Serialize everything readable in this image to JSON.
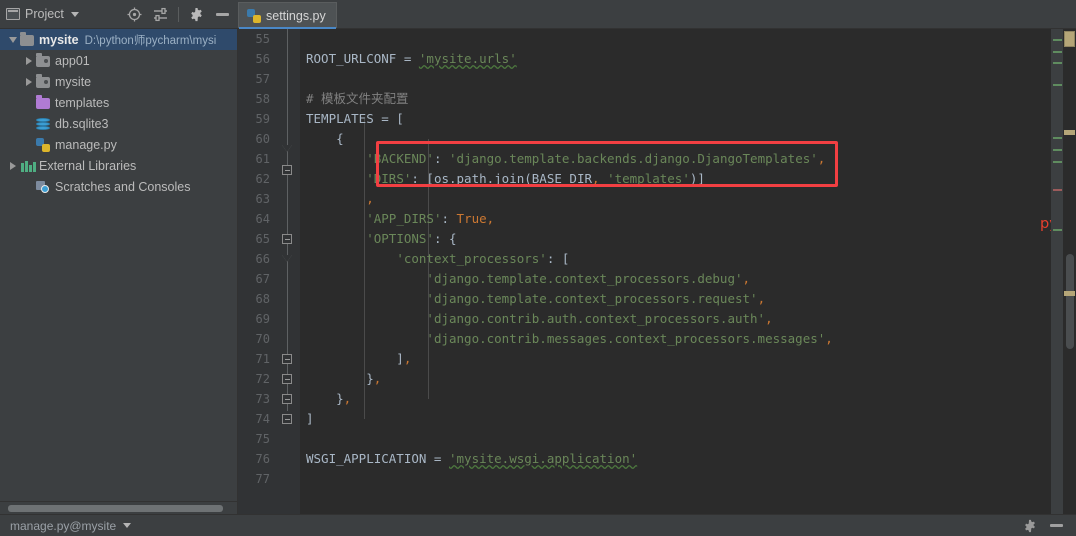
{
  "window": {
    "app": "PyCharm"
  },
  "project_toolbar": {
    "title": "Project",
    "icons": [
      {
        "name": "select-opened-file-icon",
        "glyph": "target"
      },
      {
        "name": "collapse-all-icon",
        "glyph": "sliders"
      },
      {
        "name": "settings-gear-icon",
        "glyph": "gear"
      },
      {
        "name": "hide-panel-icon",
        "glyph": "minus"
      }
    ]
  },
  "tabs": [
    {
      "label": "settings.py",
      "icon": "python-file-icon",
      "active": true
    }
  ],
  "project_tree": [
    {
      "label": "mysite",
      "path": "D:\\python师pycharm\\mysi",
      "icon": "folder-root-icon",
      "indent": 0,
      "arrow": "open",
      "selected": true,
      "bold": true
    },
    {
      "label": "app01",
      "path": "",
      "icon": "folder-module-icon",
      "indent": 1,
      "arrow": "closed",
      "selected": false,
      "bold": false
    },
    {
      "label": "mysite",
      "path": "",
      "icon": "folder-module-icon",
      "indent": 1,
      "arrow": "closed",
      "selected": false,
      "bold": false
    },
    {
      "label": "templates",
      "path": "",
      "icon": "folder-template-icon",
      "indent": 1,
      "arrow": "none",
      "selected": false,
      "bold": false
    },
    {
      "label": "db.sqlite3",
      "path": "",
      "icon": "database-file-icon",
      "indent": 1,
      "arrow": "none",
      "selected": false,
      "bold": false
    },
    {
      "label": "manage.py",
      "path": "",
      "icon": "python-file-icon",
      "indent": 1,
      "arrow": "none",
      "selected": false,
      "bold": false
    },
    {
      "label": "External Libraries",
      "path": "",
      "icon": "library-icon",
      "indent": 0,
      "arrow": "closed",
      "selected": false,
      "bold": false
    },
    {
      "label": "Scratches and Consoles",
      "path": "",
      "icon": "scratches-icon",
      "indent": 0,
      "arrow": "none",
      "selected": false,
      "bold": false
    }
  ],
  "editor": {
    "first_line": 55,
    "last_line": 77,
    "line_height": 20,
    "lines": [
      {
        "n": 55,
        "text": ""
      },
      {
        "n": 56,
        "text": "ROOT_URLCONF = 'mysite.urls'"
      },
      {
        "n": 57,
        "text": ""
      },
      {
        "n": 58,
        "text": "# 模板文件夹配置"
      },
      {
        "n": 59,
        "text": "TEMPLATES = ["
      },
      {
        "n": 60,
        "text": "    {"
      },
      {
        "n": 61,
        "text": "        'BACKEND': 'django.template.backends.django.DjangoTemplates',"
      },
      {
        "n": 62,
        "text": "        'DIRS': [os.path.join(BASE_DIR, 'templates')]"
      },
      {
        "n": 63,
        "text": "        ,"
      },
      {
        "n": 64,
        "text": "        'APP_DIRS': True,"
      },
      {
        "n": 65,
        "text": "        'OPTIONS': {"
      },
      {
        "n": 66,
        "text": "            'context_processors': ["
      },
      {
        "n": 67,
        "text": "                'django.template.context_processors.debug',"
      },
      {
        "n": 68,
        "text": "                'django.template.context_processors.request',"
      },
      {
        "n": 69,
        "text": "                'django.contrib.auth.context_processors.auth',"
      },
      {
        "n": 70,
        "text": "                'django.contrib.messages.context_processors.messages',"
      },
      {
        "n": 71,
        "text": "            ],"
      },
      {
        "n": 72,
        "text": "        },"
      },
      {
        "n": 73,
        "text": "    },"
      },
      {
        "n": 74,
        "text": "]"
      },
      {
        "n": 75,
        "text": ""
      },
      {
        "n": 76,
        "text": "WSGI_APPLICATION = 'mysite.wsgi.application'"
      },
      {
        "n": 77,
        "text": ""
      }
    ]
  },
  "annotation": {
    "note_text": "pycharm创建的帮我们添加了路",
    "box_target_line": 62,
    "box_color": "#f23f42",
    "note_color": "#e8402e"
  },
  "status_bar": {
    "run_config": "manage.py@mysite",
    "icons": [
      {
        "name": "settings-gear-icon"
      },
      {
        "name": "hide-panel-icon"
      }
    ]
  },
  "colors": {
    "editor_bg": "#2b2b2b",
    "gutter_bg": "#313335",
    "panel_bg": "#3c3f41",
    "selection_bg": "#2f4a6b",
    "tab_underline": "#4a88c7",
    "keyword": "#cc7832",
    "string": "#6a8759",
    "comment": "#808080",
    "text": "#a9b7c6",
    "line_number": "#606366"
  }
}
